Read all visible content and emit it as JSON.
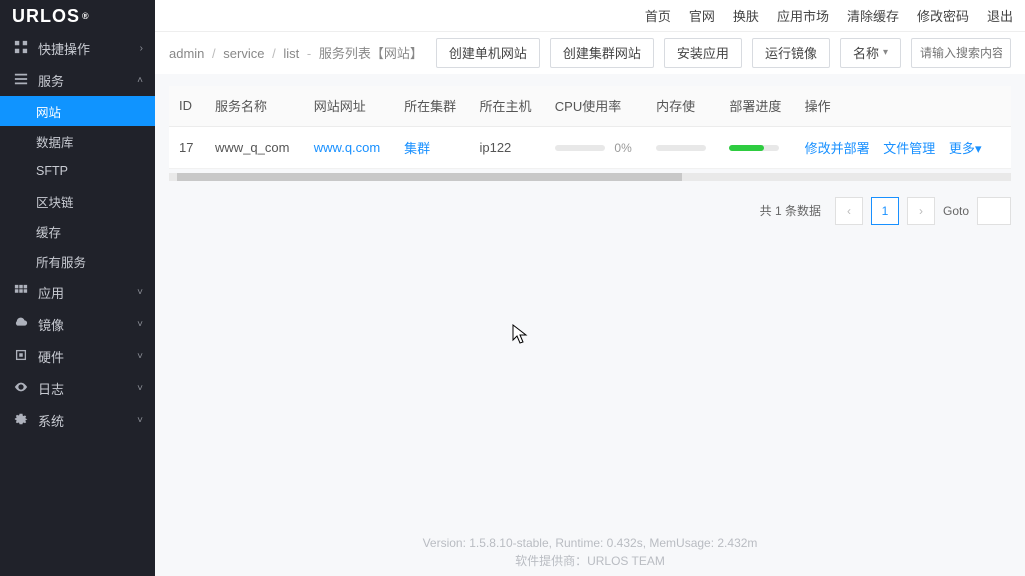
{
  "brand": {
    "name": "URLOS",
    "reg": "®"
  },
  "topnav": [
    "首页",
    "官网",
    "换肤",
    "应用市场",
    "清除缓存",
    "修改密码",
    "退出"
  ],
  "sidebar": {
    "groups": [
      {
        "icon": "grid",
        "label": "快捷操作",
        "expanded": false
      },
      {
        "icon": "bars",
        "label": "服务",
        "expanded": true,
        "children": [
          {
            "label": "网站",
            "active": true
          },
          {
            "label": "数据库"
          },
          {
            "label": "SFTP"
          },
          {
            "label": "区块链"
          },
          {
            "label": "缓存"
          },
          {
            "label": "所有服务"
          }
        ]
      },
      {
        "icon": "apps",
        "label": "应用",
        "expanded": false
      },
      {
        "icon": "cloud",
        "label": "镜像",
        "expanded": false
      },
      {
        "icon": "chip",
        "label": "硬件",
        "expanded": false
      },
      {
        "icon": "eye",
        "label": "日志",
        "expanded": false
      },
      {
        "icon": "gear",
        "label": "系统",
        "expanded": false
      }
    ]
  },
  "breadcrumb": {
    "seg1": "admin",
    "seg2": "service",
    "seg3": "list",
    "title": "服务列表【网站】"
  },
  "toolbar": {
    "btn_create_single": "创建单机网站",
    "btn_create_cluster": "创建集群网站",
    "btn_install": "安装应用",
    "btn_run_image": "运行镜像",
    "sort_label": "名称",
    "search_placeholder": "请输入搜索内容"
  },
  "table": {
    "columns": [
      "ID",
      "服务名称",
      "网站网址",
      "所在集群",
      "所在主机",
      "CPU使用率",
      "内存使",
      "部署进度",
      "操作"
    ],
    "rows": [
      {
        "id": "17",
        "name": "www_q_com",
        "url": "www.q.com",
        "cluster": "集群",
        "host": "ip122",
        "cpu": "0%",
        "actions": [
          "修改并部署",
          "文件管理",
          "更多"
        ],
        "more_chev": "▾"
      }
    ]
  },
  "pager": {
    "info": "共 1 条数据",
    "prev": "‹",
    "current": "1",
    "next": "›",
    "goto": "Goto"
  },
  "footer": {
    "line1": "Version: 1.5.8.10-stable,   Runtime: 0.432s,   MemUsage: 2.432m",
    "line2": "软件提供商：URLOS TEAM"
  }
}
